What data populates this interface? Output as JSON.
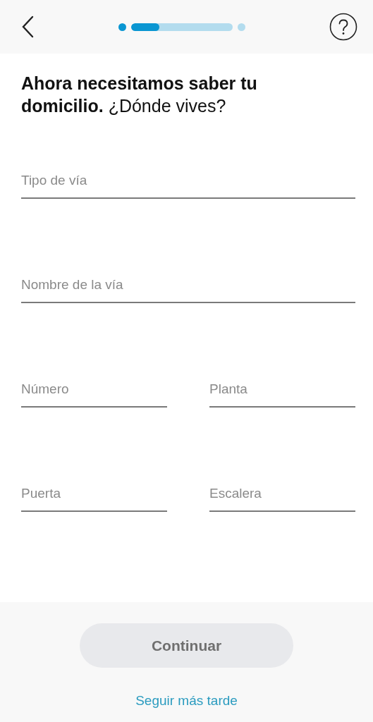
{
  "progress": {
    "level": 0.28,
    "first_step_done": true,
    "last_step_done": false
  },
  "heading": "**Ahora necesitamos saber tu domicilio.** ¿Dónde vives?",
  "field_rows": [
    [
      {
        "placeholder": "Tipo de vía"
      }
    ],
    [
      {
        "placeholder": "Nombre de la vía"
      }
    ],
    [
      {
        "placeholder": "Número"
      },
      {
        "placeholder": "Planta"
      }
    ],
    [
      {
        "placeholder": "Puerta"
      },
      {
        "placeholder": "Escalera"
      }
    ]
  ],
  "continue_button": {
    "label": "Continuar",
    "disabled": true
  },
  "later_link": "Seguir más tarde"
}
